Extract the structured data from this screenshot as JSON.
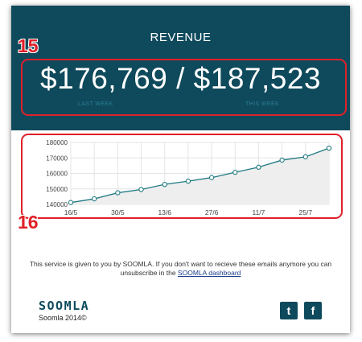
{
  "header": {
    "title": "REVENUE",
    "amount": "$176,769 / $187,523",
    "last_week_label": "LAST WEEK",
    "this_week_label": "THIS WEEK"
  },
  "callouts": {
    "first": "15",
    "second": "16"
  },
  "chart_data": {
    "type": "line",
    "x": [
      "16/5",
      "23/5",
      "30/5",
      "6/6",
      "13/6",
      "20/6",
      "27/6",
      "4/7",
      "11/7",
      "18/7",
      "25/7",
      "1/8"
    ],
    "tick_labels": [
      "16/5",
      "30/5",
      "13/6",
      "27/6",
      "11/7",
      "25/7"
    ],
    "series": [
      {
        "values": [
          141200,
          143600,
          147500,
          149600,
          152900,
          155000,
          157300,
          160700,
          164000,
          168600,
          170700,
          176300
        ]
      }
    ],
    "yticks": [
      140000,
      150000,
      160000,
      170000,
      180000
    ],
    "ylim": [
      140000,
      180000
    ],
    "grid": true,
    "colors": {
      "line": "#1f7a82",
      "area": "#eeeeee",
      "grid": "#e4e4e4"
    }
  },
  "footer": {
    "text": "This service is given to you by SOOMLA. If you don't want to recieve these emails anymore you can unsubscribe in the",
    "link": "SOOMLA dashboard",
    "logo": "SOOMLA",
    "copyright": "Soomla 2014©"
  },
  "social": {
    "twitter_icon": "t",
    "facebook_icon": "f"
  },
  "colors": {
    "brand": "#0e4a5c",
    "annotation": "#e0202a",
    "sublabel": "#2e7e97"
  }
}
